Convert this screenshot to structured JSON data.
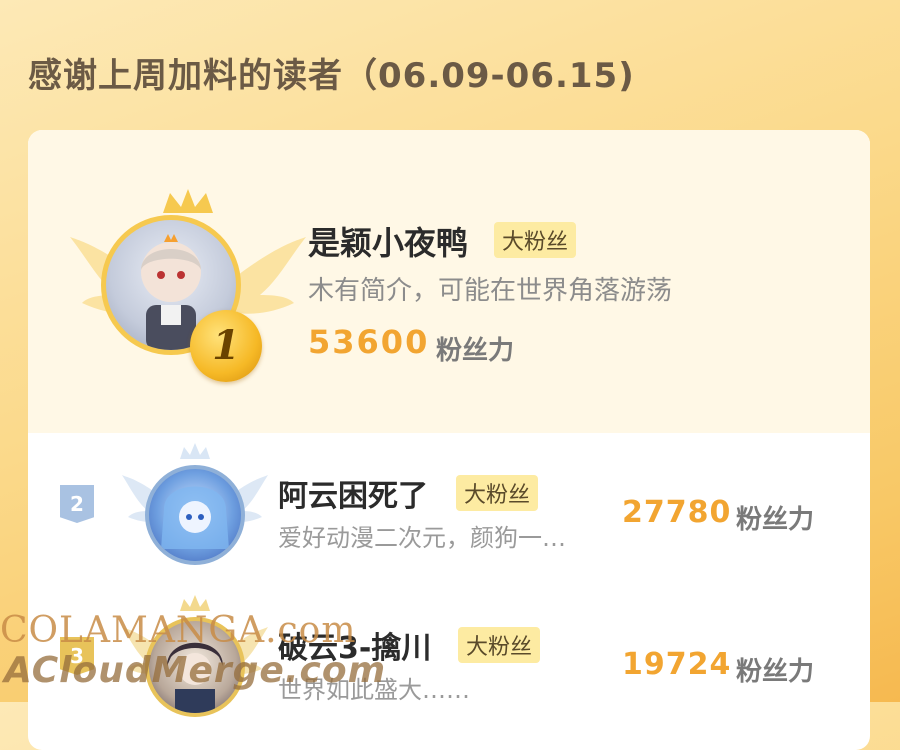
{
  "page": {
    "title": "感谢上周加料的读者（06.09-06.15)"
  },
  "rank1": {
    "rank": "1",
    "name": "是颖小夜鸭",
    "badge": "大粉丝",
    "bio": "木有简介，可能在世界角落游荡",
    "score": "53600",
    "unit": "粉丝力"
  },
  "rows": [
    {
      "rank": "2",
      "name": "阿云困死了",
      "badge": "大粉丝",
      "bio": "爱好动漫二次元，颜狗一…",
      "score": "27780",
      "unit": "粉丝力"
    },
    {
      "rank": "3",
      "name": "破云3-擒川",
      "badge": "大粉丝",
      "bio": "世界如此盛大……",
      "score": "19724",
      "unit": "粉丝力"
    }
  ],
  "watermark": {
    "line1": "COLAMANGA.com",
    "line2": "ACloudMerge.com"
  },
  "colors": {
    "accent_gold": "#f2a531",
    "badge_bg": "#fdeba2",
    "rank2_blue": "#8fb0d8",
    "rank3_gold": "#e8c35a"
  }
}
